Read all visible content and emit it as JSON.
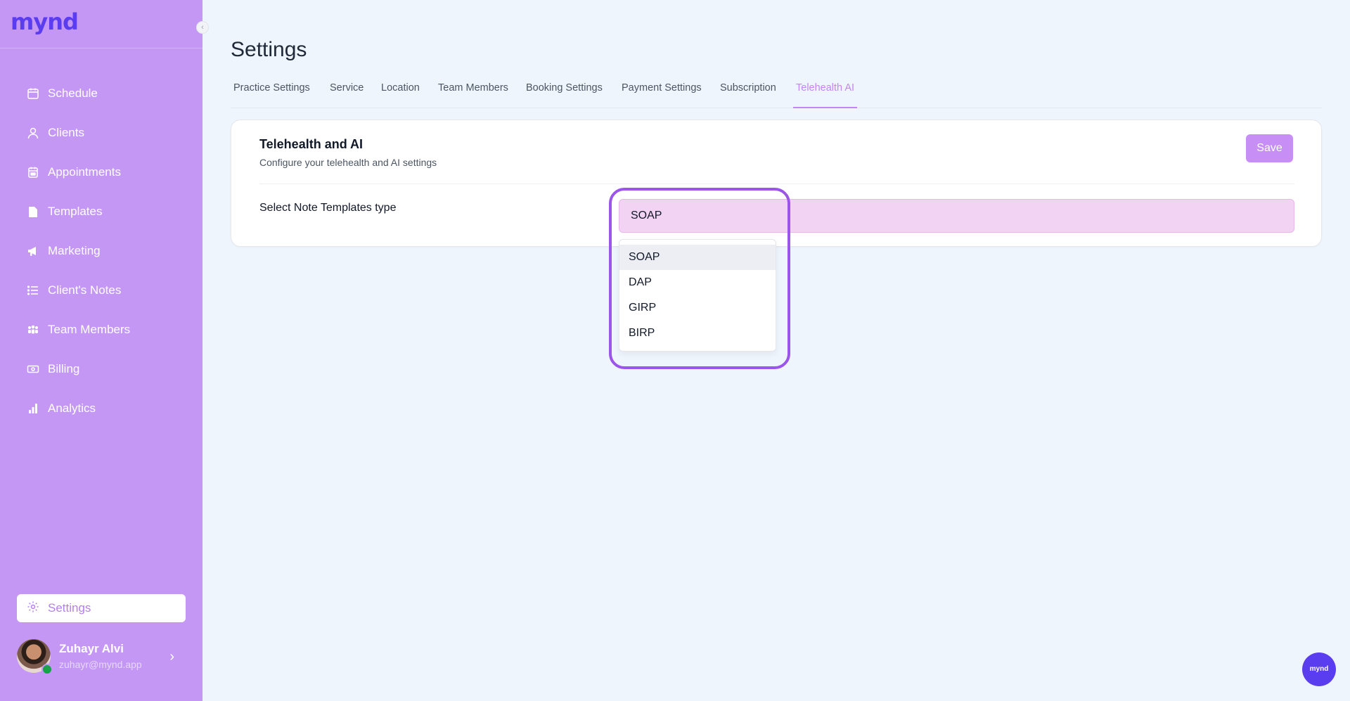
{
  "app": {
    "logo": "mynd",
    "fab_label": "mynd"
  },
  "sidebar": {
    "items": [
      {
        "label": "Schedule",
        "icon": "calendar-icon"
      },
      {
        "label": "Clients",
        "icon": "user-icon"
      },
      {
        "label": "Appointments",
        "icon": "calendar-check-icon"
      },
      {
        "label": "Templates",
        "icon": "document-icon"
      },
      {
        "label": "Marketing",
        "icon": "megaphone-icon"
      },
      {
        "label": "Client's Notes",
        "icon": "list-icon"
      },
      {
        "label": "Team Members",
        "icon": "team-icon"
      },
      {
        "label": "Billing",
        "icon": "cash-icon"
      },
      {
        "label": "Analytics",
        "icon": "bar-chart-icon"
      }
    ],
    "settings_label": "Settings",
    "user": {
      "name": "Zuhayr Alvi",
      "email": "zuhayr@mynd.app"
    }
  },
  "main": {
    "title": "Settings",
    "tabs": [
      {
        "label": "Practice Settings"
      },
      {
        "label": "Service"
      },
      {
        "label": "Location"
      },
      {
        "label": "Team Members"
      },
      {
        "label": "Booking Settings"
      },
      {
        "label": "Payment Settings"
      },
      {
        "label": "Subscription"
      },
      {
        "label": "Telehealth AI",
        "active": true
      }
    ],
    "card": {
      "title": "Telehealth and AI",
      "subtitle": "Configure your telehealth and AI settings",
      "save_label": "Save",
      "field_label": "Select Note Templates type",
      "select_value": "SOAP",
      "options": [
        "SOAP",
        "DAP",
        "GIRP",
        "BIRP"
      ]
    }
  },
  "colors": {
    "sidebar_bg": "#c497f5",
    "accent": "#c185f4",
    "brand": "#5b3df0",
    "highlight_ring": "#9b55ea"
  }
}
